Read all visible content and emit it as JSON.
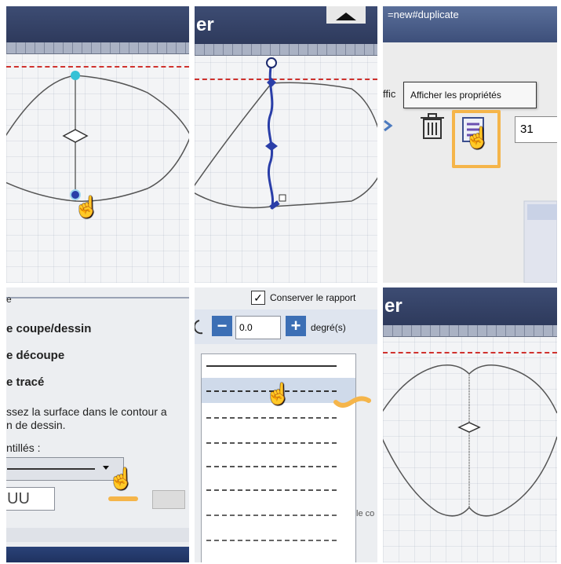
{
  "panel3": {
    "url_fragment": "=new#duplicate",
    "partial_label": "ffic",
    "tooltip": "Afficher les propriétés",
    "number_value": "31"
  },
  "panel4": {
    "option1": "e coupe/dessin",
    "option2": "e découpe",
    "option3": "e tracé",
    "description": "ssez la surface dans le contour a\nn de dessin.",
    "dashes_label": "ntillés :",
    "partial_number": "UU"
  },
  "panel5": {
    "keep_ratio_label": "Conserver le rapport",
    "minus_label": "−",
    "plus_label": "+",
    "angle_value": "0.0",
    "degree_unit": "degré(s)",
    "side_text": "le co"
  },
  "panel2": {
    "title_fragment": "er"
  },
  "panel6": {
    "title_fragment": "er"
  },
  "colors": {
    "highlight": "#f5b54a",
    "accent_blue": "#3c6fb5",
    "handle_blue": "#2a3ea8",
    "handle_cyan": "#35c2d6"
  }
}
